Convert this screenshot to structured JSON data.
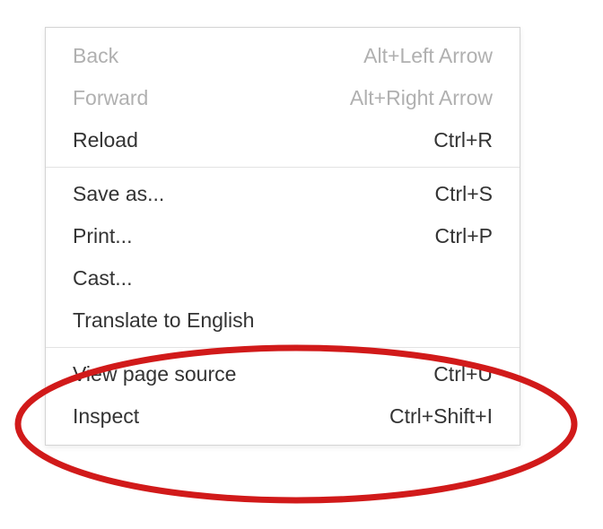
{
  "menu": {
    "sections": [
      {
        "items": [
          {
            "id": "back",
            "label": "Back",
            "shortcut": "Alt+Left Arrow",
            "disabled": true
          },
          {
            "id": "forward",
            "label": "Forward",
            "shortcut": "Alt+Right Arrow",
            "disabled": true
          },
          {
            "id": "reload",
            "label": "Reload",
            "shortcut": "Ctrl+R",
            "disabled": false
          }
        ]
      },
      {
        "items": [
          {
            "id": "save-as",
            "label": "Save as...",
            "shortcut": "Ctrl+S",
            "disabled": false
          },
          {
            "id": "print",
            "label": "Print...",
            "shortcut": "Ctrl+P",
            "disabled": false
          },
          {
            "id": "cast",
            "label": "Cast...",
            "shortcut": "",
            "disabled": false
          },
          {
            "id": "translate",
            "label": "Translate to English",
            "shortcut": "",
            "disabled": false
          }
        ]
      },
      {
        "items": [
          {
            "id": "view-source",
            "label": "View page source",
            "shortcut": "Ctrl+U",
            "disabled": false
          },
          {
            "id": "inspect",
            "label": "Inspect",
            "shortcut": "Ctrl+Shift+I",
            "disabled": false
          }
        ]
      }
    ]
  },
  "annotation": {
    "color": "#d11a1a",
    "stroke_width": 7
  }
}
